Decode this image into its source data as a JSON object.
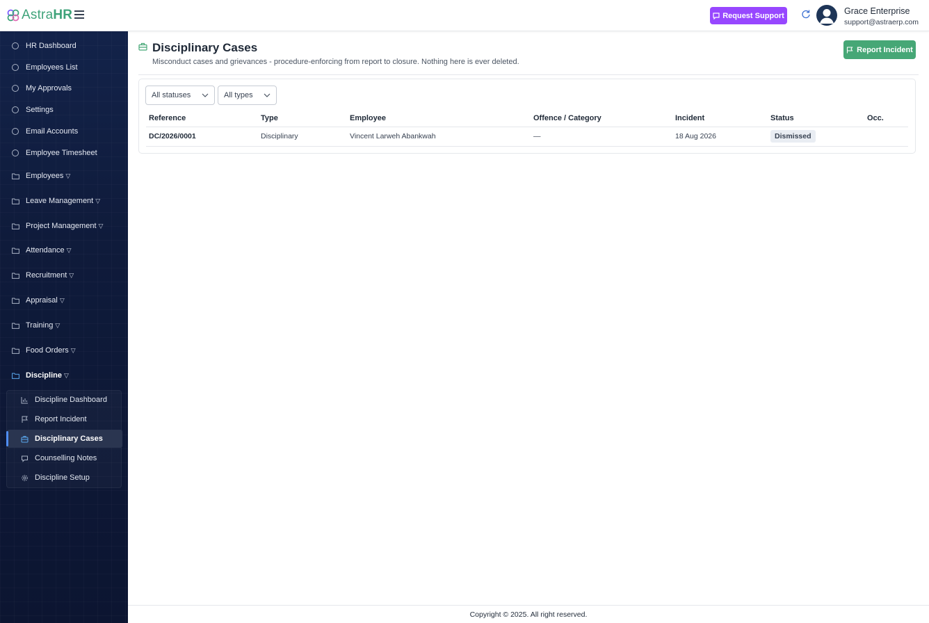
{
  "brand": {
    "name_prefix": "Astra",
    "name_suffix": "HR",
    "color": "#3fa37a"
  },
  "header": {
    "support_label": "Request Support",
    "user_name": "Grace Enterprise",
    "user_email": "support@astraerp.com"
  },
  "sidebar": {
    "items": [
      {
        "label": "HR Dashboard"
      },
      {
        "label": "Employees List"
      },
      {
        "label": "My Approvals"
      },
      {
        "label": "Settings"
      },
      {
        "label": "Email Accounts"
      },
      {
        "label": "Employee Timesheet"
      }
    ],
    "groups": [
      {
        "label": "Employees"
      },
      {
        "label": "Leave Management"
      },
      {
        "label": "Project Management"
      },
      {
        "label": "Attendance"
      },
      {
        "label": "Recruitment"
      },
      {
        "label": "Appraisal"
      },
      {
        "label": "Training"
      },
      {
        "label": "Food Orders"
      },
      {
        "label": "Discipline"
      }
    ],
    "discipline_sub": [
      {
        "label": "Discipline Dashboard",
        "icon": "bar-chart-icon"
      },
      {
        "label": "Report Incident",
        "icon": "flag-icon"
      },
      {
        "label": "Disciplinary Cases",
        "icon": "briefcase-icon"
      },
      {
        "label": "Counselling Notes",
        "icon": "chat-icon"
      },
      {
        "label": "Discipline Setup",
        "icon": "gear-icon"
      }
    ]
  },
  "page": {
    "title": "Disciplinary Cases",
    "subtitle": "Misconduct cases and grievances - procedure-enforcing from report to closure. Nothing here is ever deleted.",
    "report_button": "Report Incident"
  },
  "filters": {
    "status": "All statuses",
    "type": "All types"
  },
  "table": {
    "headers": [
      "Reference",
      "Type",
      "Employee",
      "Offence / Category",
      "Incident",
      "Status",
      "Occ."
    ],
    "rows": [
      {
        "reference": "DC/2026/0001",
        "type": "Disciplinary",
        "employee": "Vincent Larweh Abankwah",
        "offence": "—",
        "incident": "18 Aug 2026",
        "status": "Dismissed",
        "occ": ""
      }
    ]
  },
  "footer": {
    "text": "Copyright © 2025. All right reserved."
  },
  "colors": {
    "support": "#9747ff",
    "report": "#46a776",
    "sidebar": "#0f1b3b",
    "active_indicator": "#4f8ef7"
  }
}
